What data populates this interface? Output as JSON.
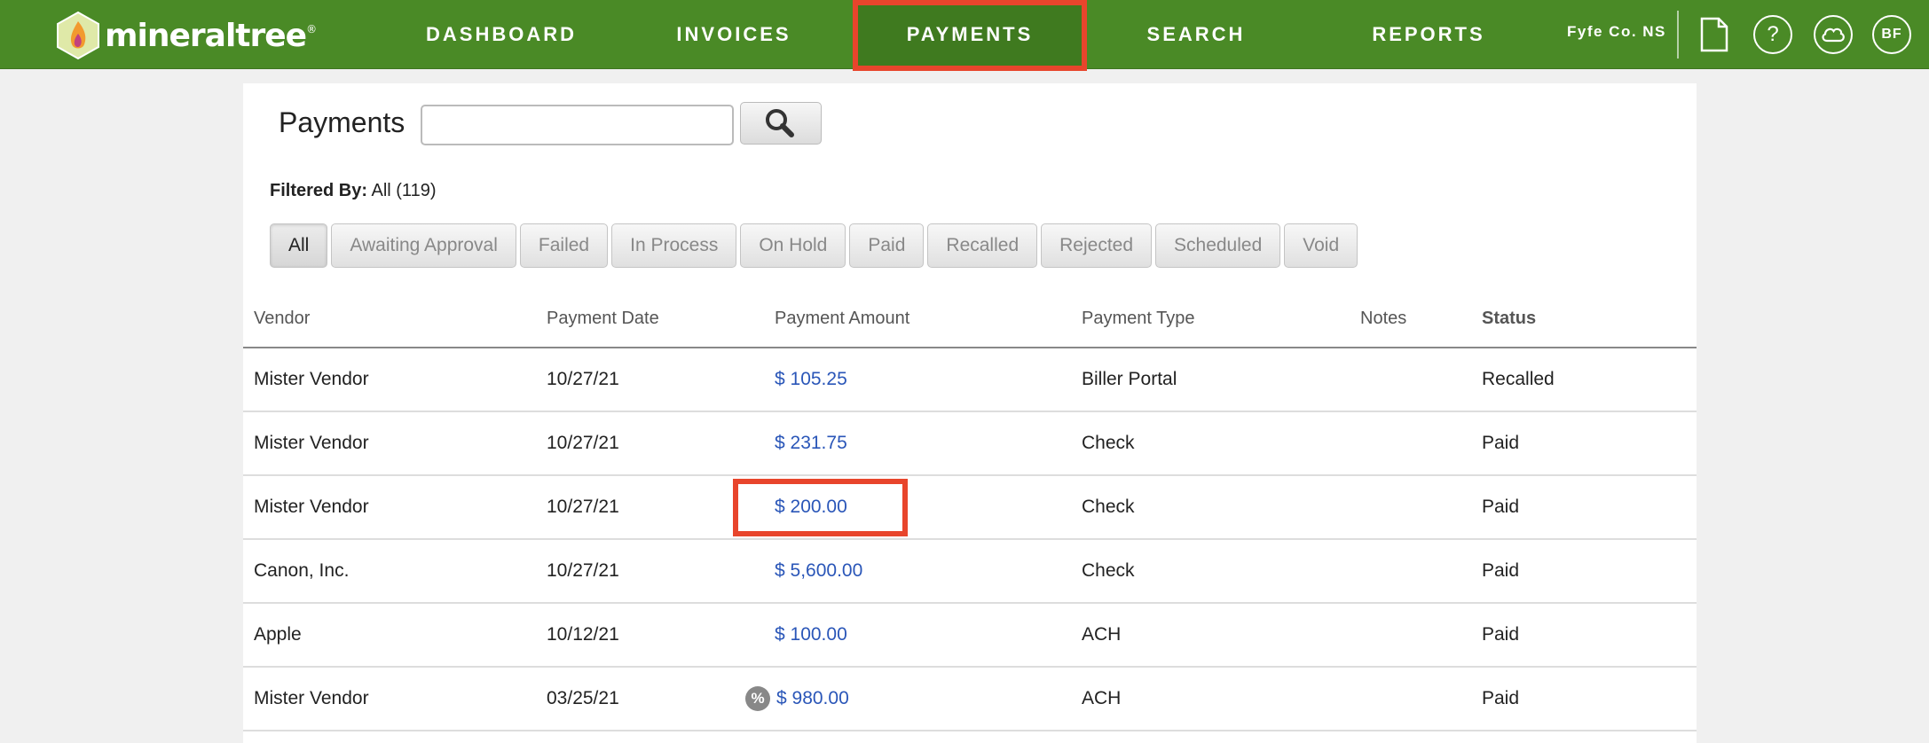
{
  "app": {
    "logo_text": "mineraltree",
    "logo_mark": "®",
    "brand_color": "#4a8a26",
    "highlight_color": "#e8452c"
  },
  "nav": {
    "items": [
      {
        "label": "DASHBOARD"
      },
      {
        "label": "INVOICES"
      },
      {
        "label": "PAYMENTS",
        "active": true
      },
      {
        "label": "SEARCH"
      },
      {
        "label": "REPORTS"
      }
    ],
    "company": "Fyfe Co. NS",
    "icons": [
      "document-icon",
      "help-icon",
      "cloud-icon"
    ],
    "help_glyph": "?",
    "avatar": "BF"
  },
  "page": {
    "title": "Payments",
    "search_placeholder": "",
    "filtered_label": "Filtered By:",
    "filtered_value": "All (119)",
    "filters": [
      {
        "label": "All",
        "selected": true
      },
      {
        "label": "Awaiting Approval"
      },
      {
        "label": "Failed"
      },
      {
        "label": "In Process"
      },
      {
        "label": "On Hold"
      },
      {
        "label": "Paid"
      },
      {
        "label": "Recalled"
      },
      {
        "label": "Rejected"
      },
      {
        "label": "Scheduled"
      },
      {
        "label": "Void"
      }
    ]
  },
  "table": {
    "columns": [
      "Vendor",
      "Payment Date",
      "Payment Amount",
      "Payment Type",
      "Notes",
      "Status"
    ],
    "rows": [
      {
        "vendor": "Mister Vendor",
        "date": "10/27/21",
        "amount": "$ 105.25",
        "type": "Biller Portal",
        "notes": "",
        "status": "Recalled"
      },
      {
        "vendor": "Mister Vendor",
        "date": "10/27/21",
        "amount": "$ 231.75",
        "type": "Check",
        "notes": "",
        "status": "Paid"
      },
      {
        "vendor": "Mister Vendor",
        "date": "10/27/21",
        "amount": "$ 200.00",
        "type": "Check",
        "notes": "",
        "status": "Paid",
        "highlighted": true
      },
      {
        "vendor": "Canon, Inc.",
        "date": "10/27/21",
        "amount": "$ 5,600.00",
        "type": "Check",
        "notes": "",
        "status": "Paid"
      },
      {
        "vendor": "Apple",
        "date": "10/12/21",
        "amount": "$ 100.00",
        "type": "ACH",
        "notes": "",
        "status": "Paid"
      },
      {
        "vendor": "Mister Vendor",
        "date": "03/25/21",
        "amount": "$ 980.00",
        "type": "ACH",
        "notes": "",
        "status": "Paid",
        "discount_badge": "%"
      }
    ]
  }
}
